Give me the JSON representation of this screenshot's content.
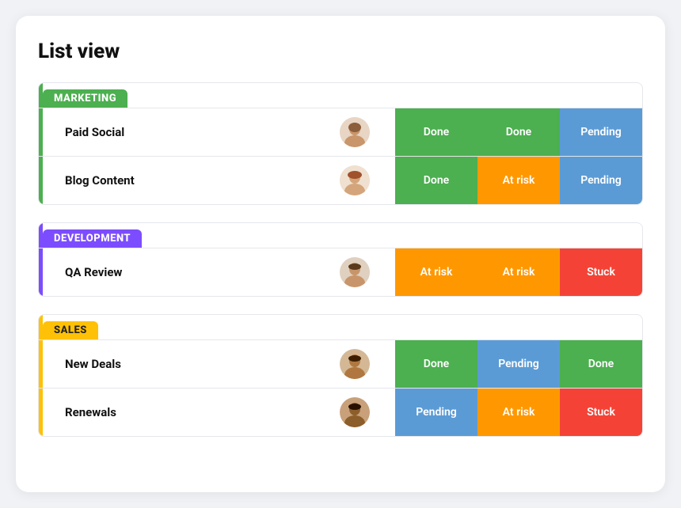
{
  "page": {
    "title": "List view"
  },
  "groups": [
    {
      "id": "marketing",
      "label": "MARKETING",
      "label_class": "group-label-marketing",
      "bar_class": "bar-marketing",
      "rows": [
        {
          "name": "Paid Social",
          "avatar_id": "woman1",
          "statuses": [
            {
              "label": "Done",
              "class": "status-done"
            },
            {
              "label": "Done",
              "class": "status-done"
            },
            {
              "label": "Pending",
              "class": "status-pending"
            }
          ]
        },
        {
          "name": "Blog Content",
          "avatar_id": "woman2",
          "statuses": [
            {
              "label": "Done",
              "class": "status-done"
            },
            {
              "label": "At risk",
              "class": "status-at-risk"
            },
            {
              "label": "Pending",
              "class": "status-pending"
            }
          ]
        }
      ]
    },
    {
      "id": "development",
      "label": "DEVELOPMENT",
      "label_class": "group-label-development",
      "bar_class": "bar-development",
      "rows": [
        {
          "name": "QA Review",
          "avatar_id": "man1",
          "statuses": [
            {
              "label": "At risk",
              "class": "status-at-risk"
            },
            {
              "label": "At risk",
              "class": "status-at-risk"
            },
            {
              "label": "Stuck",
              "class": "status-stuck"
            }
          ]
        }
      ]
    },
    {
      "id": "sales",
      "label": "SALES",
      "label_class": "group-label-sales",
      "bar_class": "bar-sales",
      "rows": [
        {
          "name": "New Deals",
          "avatar_id": "man2",
          "statuses": [
            {
              "label": "Done",
              "class": "status-done"
            },
            {
              "label": "Pending",
              "class": "status-pending"
            },
            {
              "label": "Done",
              "class": "status-done"
            }
          ]
        },
        {
          "name": "Renewals",
          "avatar_id": "man3",
          "statuses": [
            {
              "label": "Pending",
              "class": "status-pending"
            },
            {
              "label": "At risk",
              "class": "status-at-risk"
            },
            {
              "label": "Stuck",
              "class": "status-stuck"
            }
          ]
        }
      ]
    }
  ]
}
